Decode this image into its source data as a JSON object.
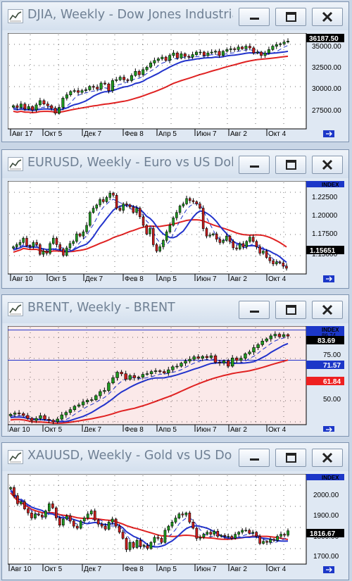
{
  "colors": {
    "bull": "#1f9a1f",
    "bear": "#cc1e1e",
    "ma_fast": "#2233cc",
    "ma_slow": "#e02222",
    "window_bg": "#dfe8f3",
    "plot_bg": "#ffffff",
    "brent_bg": "#fbe9e9"
  },
  "icons": {
    "app": "chart-app-icon",
    "minimize": "minimize-icon",
    "maximize": "maximize-icon",
    "close": "close-icon",
    "scroll": "scroll-end-icon"
  },
  "windows": [
    {
      "title": "DJIA, Weekly - Dow Jones Industria...",
      "axis_labels": [
        "35000.00",
        "32500.00",
        "30000.00",
        "27500.00"
      ],
      "price_label": "36187.50",
      "x_labels": [
        "Авг 17",
        "Окт 5",
        "Дек 7",
        "Фев 8",
        "Апр 5",
        "Июн 7",
        "Авг 2",
        "Окт 4"
      ]
    },
    {
      "title": "EURUSD, Weekly - Euro vs US Dollar",
      "index_label": "INDEX",
      "axis_labels": [
        "1.22500",
        "1.20000",
        "1.17500",
        "1.15000"
      ],
      "price_label": "1.15651",
      "x_labels": [
        "Авг 10",
        "Окт 5",
        "Дек 7",
        "Фев 8",
        "Апр 5",
        "Июн 7",
        "Авг 2",
        "Окт 4"
      ]
    },
    {
      "title": "BRENT, Weekly - BRENT",
      "index_label": "INDEX",
      "axis_labels": [
        "75.00",
        "50.00"
      ],
      "line_labels": [
        "86.74",
        "71.57",
        "61.84"
      ],
      "price_label": "83.69",
      "x_labels": [
        "Авг 10",
        "Окт 5",
        "Дек 7",
        "Фев 8",
        "Апр 5",
        "Июн 7",
        "Авг 2",
        "Окт 4"
      ]
    },
    {
      "title": "XAUUSD, Weekly - Gold vs US Dollar",
      "index_label": "INDEX",
      "axis_labels": [
        "2000.00",
        "1900.00",
        "1800.00",
        "1700.00"
      ],
      "price_label": "1816.67",
      "x_labels": [
        "Авг 10",
        "Окт 5",
        "Дек 7",
        "Фев 8",
        "Апр 5",
        "Июн 7",
        "Авг 2",
        "Окт 4"
      ]
    }
  ],
  "chart_data": [
    {
      "type": "candlestick",
      "symbol": "DJIA",
      "timeframe": "Weekly",
      "ylim": [
        25800,
        36900
      ],
      "close": [
        28400,
        28200,
        28600,
        28000,
        28300,
        27900,
        28500,
        29000,
        28600,
        28400,
        28100,
        27500,
        28200,
        29300,
        29700,
        30100,
        30200,
        30000,
        30200,
        30300,
        30700,
        30600,
        30400,
        31100,
        31000,
        30200,
        31400,
        31500,
        31800,
        31500,
        31400,
        32000,
        32500,
        32100,
        32700,
        33000,
        33500,
        33800,
        34000,
        34200,
        33800,
        34400,
        34700,
        34100,
        34600,
        34300,
        34200,
        34500,
        34800,
        34800,
        34400,
        34700,
        34800,
        34900,
        34400,
        34900,
        35100,
        35200,
        35100,
        35400,
        35200,
        35500,
        35300,
        34700,
        34800,
        34400,
        34700,
        35100,
        35500,
        35700,
        35800,
        36000,
        36100
      ]
    },
    {
      "type": "candlestick",
      "symbol": "EURUSD",
      "timeframe": "Weekly",
      "ylim": [
        1.152,
        1.236
      ],
      "close": [
        1.176,
        1.178,
        1.18,
        1.184,
        1.177,
        1.176,
        1.18,
        1.178,
        1.169,
        1.172,
        1.17,
        1.179,
        1.184,
        1.178,
        1.174,
        1.168,
        1.175,
        1.179,
        1.181,
        1.188,
        1.186,
        1.19,
        1.196,
        1.208,
        1.212,
        1.215,
        1.22,
        1.218,
        1.222,
        1.226,
        1.224,
        1.212,
        1.21,
        1.216,
        1.215,
        1.213,
        1.208,
        1.212,
        1.204,
        1.196,
        1.188,
        1.193,
        1.178,
        1.172,
        1.176,
        1.182,
        1.19,
        1.196,
        1.203,
        1.208,
        1.214,
        1.216,
        1.221,
        1.219,
        1.218,
        1.216,
        1.212,
        1.193,
        1.186,
        1.187,
        1.188,
        1.183,
        1.18,
        1.182,
        1.186,
        1.181,
        1.175,
        1.174,
        1.179,
        1.176,
        1.181,
        1.185,
        1.181,
        1.176,
        1.17,
        1.172,
        1.166,
        1.163,
        1.16,
        1.162,
        1.161,
        1.158,
        1.156
      ]
    },
    {
      "type": "candlestick",
      "symbol": "BRENT",
      "timeframe": "Weekly",
      "ylim": [
        40,
        88
      ],
      "close": [
        44.5,
        45.1,
        44.8,
        43.9,
        42.5,
        41.4,
        42.4,
        43.8,
        42.0,
        41.5,
        40.8,
        42.1,
        44.2,
        45.4,
        46.8,
        48.5,
        49.2,
        50.7,
        51.5,
        51.8,
        53.8,
        55.9,
        56.4,
        60.2,
        62.8,
        65.6,
        64.8,
        62.0,
        63.9,
        62.8,
        63.1,
        64.5,
        64.8,
        65.9,
        66.3,
        65.9,
        65.2,
        66.8,
        68.3,
        68.6,
        70.1,
        71.2,
        72.1,
        73.3,
        72.6,
        73.5,
        72.9,
        73.8,
        70.5,
        70.2,
        71.3,
        68.6,
        72.7,
        71.5,
        72.6,
        74.8,
        75.7,
        77.9,
        79.4,
        81.2,
        82.3,
        83.8,
        84.6,
        83.4,
        84.4,
        83.7
      ]
    },
    {
      "type": "candlestick",
      "symbol": "XAUUSD",
      "timeframe": "Weekly",
      "ylim": [
        1660,
        2090
      ],
      "close": [
        2030,
        1990,
        1950,
        1960,
        1925,
        1905,
        1880,
        1900,
        1895,
        1885,
        1915,
        1950,
        1930,
        1880,
        1845,
        1875,
        1890,
        1865,
        1840,
        1830,
        1865,
        1880,
        1900,
        1915,
        1870,
        1850,
        1840,
        1825,
        1860,
        1875,
        1840,
        1810,
        1780,
        1725,
        1760,
        1735,
        1770,
        1740,
        1745,
        1730,
        1760,
        1785,
        1780,
        1760,
        1820,
        1840,
        1860,
        1880,
        1900,
        1895,
        1905,
        1860,
        1830,
        1780,
        1785,
        1800,
        1810,
        1800,
        1815,
        1790,
        1795,
        1790,
        1790,
        1780,
        1800,
        1810,
        1820,
        1820,
        1805,
        1810,
        1790,
        1755,
        1765,
        1760,
        1775,
        1770,
        1790,
        1800,
        1795,
        1817
      ]
    }
  ]
}
